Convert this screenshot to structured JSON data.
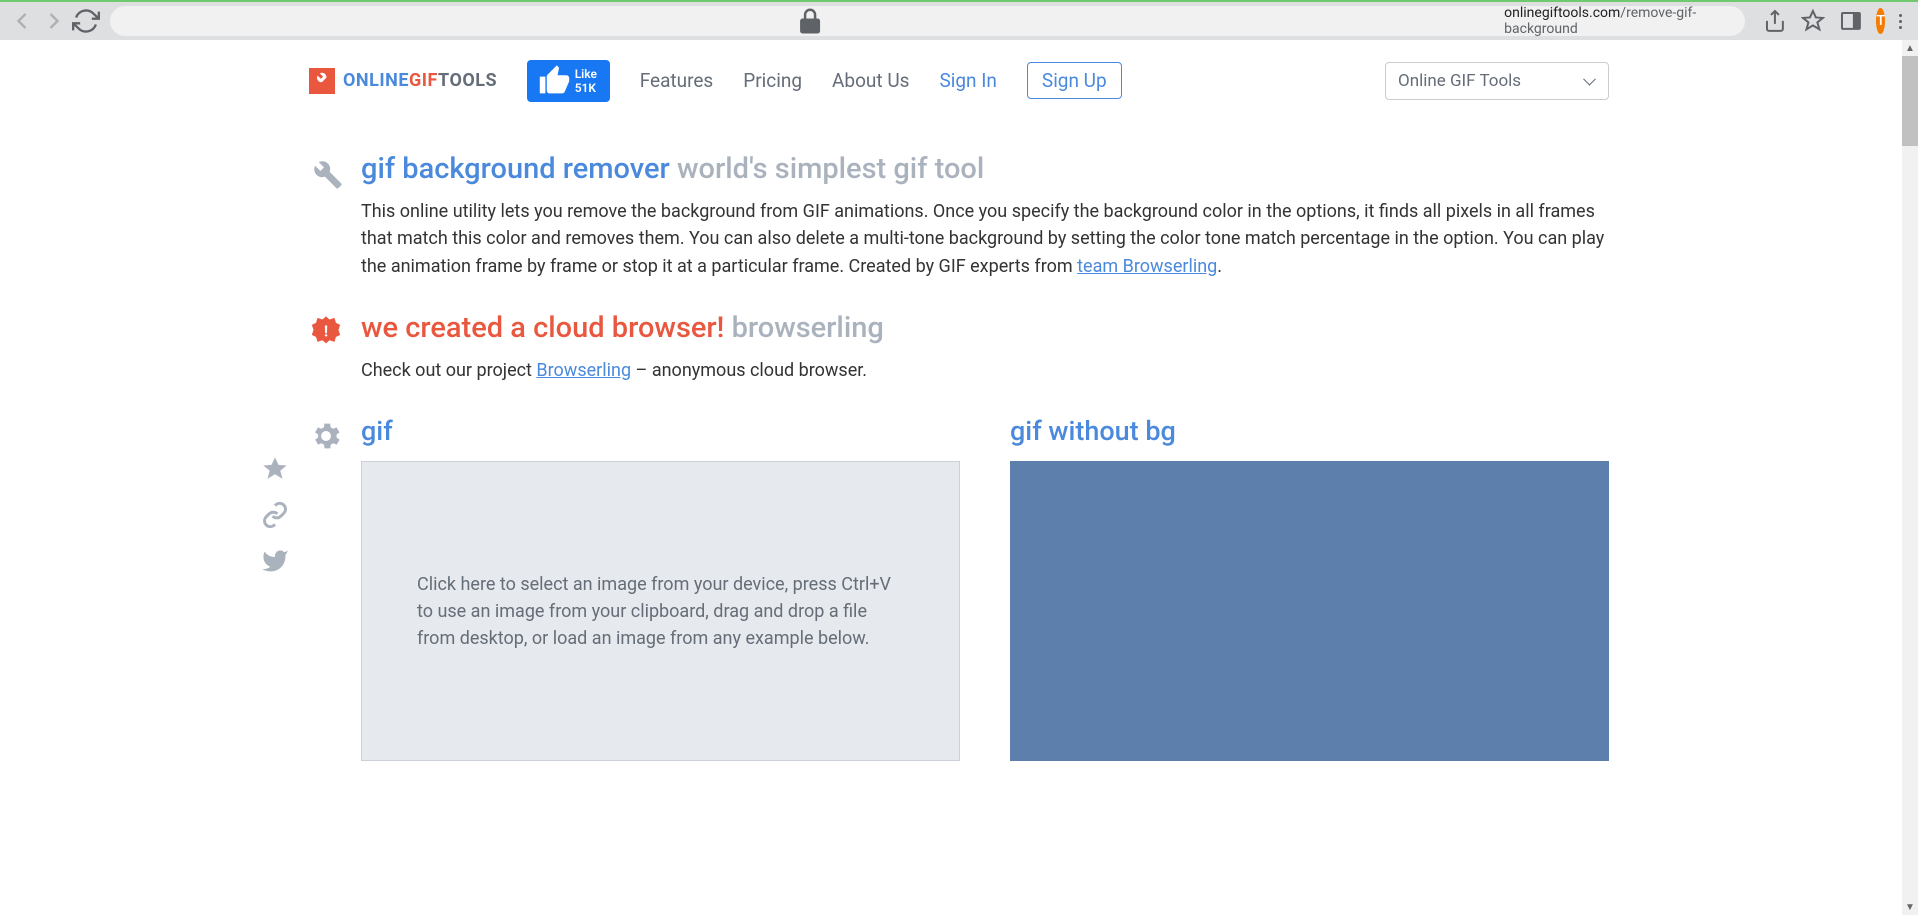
{
  "browser": {
    "url_host": "onlinegiftools.com",
    "url_path": "/remove-gif-background",
    "avatar_letter": "T"
  },
  "nav": {
    "logo": {
      "part1": "ONLINE",
      "part2": "GIF",
      "part3": "TOOLS"
    },
    "fb_like": "Like 51K",
    "links": {
      "features": "Features",
      "pricing": "Pricing",
      "about": "About Us",
      "signin": "Sign In",
      "signup": "Sign Up"
    },
    "select_label": "Online GIF Tools"
  },
  "hero": {
    "title_main": "gif background remover",
    "title_sub": "world's simplest gif tool",
    "description_pre": "This online utility lets you remove the background from GIF animations. Once you specify the background color in the options, it finds all pixels in all frames that match this color and removes them. You can also delete a multi-tone background by setting the color tone match percentage in the option. You can play the animation frame by frame or stop it at a particular frame. Created by GIF experts from ",
    "description_link": "team Browserling",
    "description_post": "."
  },
  "promo": {
    "title_main": "we created a cloud browser!",
    "title_sub": "browserling",
    "text_pre": "Check out our project ",
    "text_link": "Browserling",
    "text_post": " – anonymous cloud browser."
  },
  "tool": {
    "input_label": "gif",
    "output_label": "gif without bg",
    "dropzone_text": "Click here to select an image from your device, press Ctrl+V to use an image from your clipboard, drag and drop a file from desktop, or load an image from any example below."
  }
}
